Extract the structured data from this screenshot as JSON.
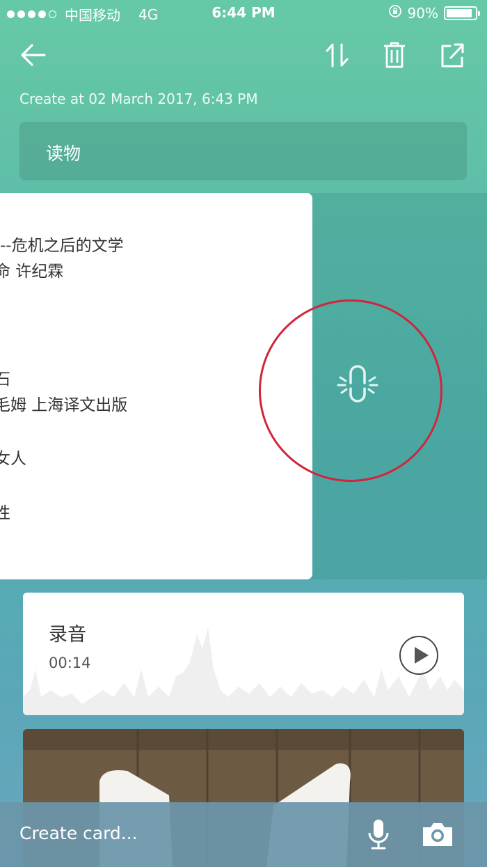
{
  "status_bar": {
    "carrier": "中国移动",
    "network": "4G",
    "time": "6:44 PM",
    "battery_percent": "90%",
    "battery_level": 0.9
  },
  "toolbar": {
    "back_icon": "arrow-left-icon",
    "sort_icon": "sort-arrows-icon",
    "delete_icon": "trash-icon",
    "share_icon": "share-icon"
  },
  "note": {
    "created": "Create at 02 March 2017, 6:43 PM",
    "title": "读物",
    "lines": [
      "--危机之后的文学",
      "命 许纪霖",
      "石",
      "毛姆 上海译文出版",
      "女人",
      "性"
    ]
  },
  "swipe_action": {
    "icon": "pin-icon"
  },
  "audio": {
    "title": "录音",
    "duration": "00:14",
    "play_icon": "play-icon"
  },
  "bottom_bar": {
    "placeholder": "Create card...",
    "mic_icon": "microphone-icon",
    "camera_icon": "camera-icon"
  },
  "colors": {
    "highlight_circle": "#d0253a",
    "gradient_top": "#66c9a6",
    "gradient_bottom": "#6aa6bd"
  }
}
